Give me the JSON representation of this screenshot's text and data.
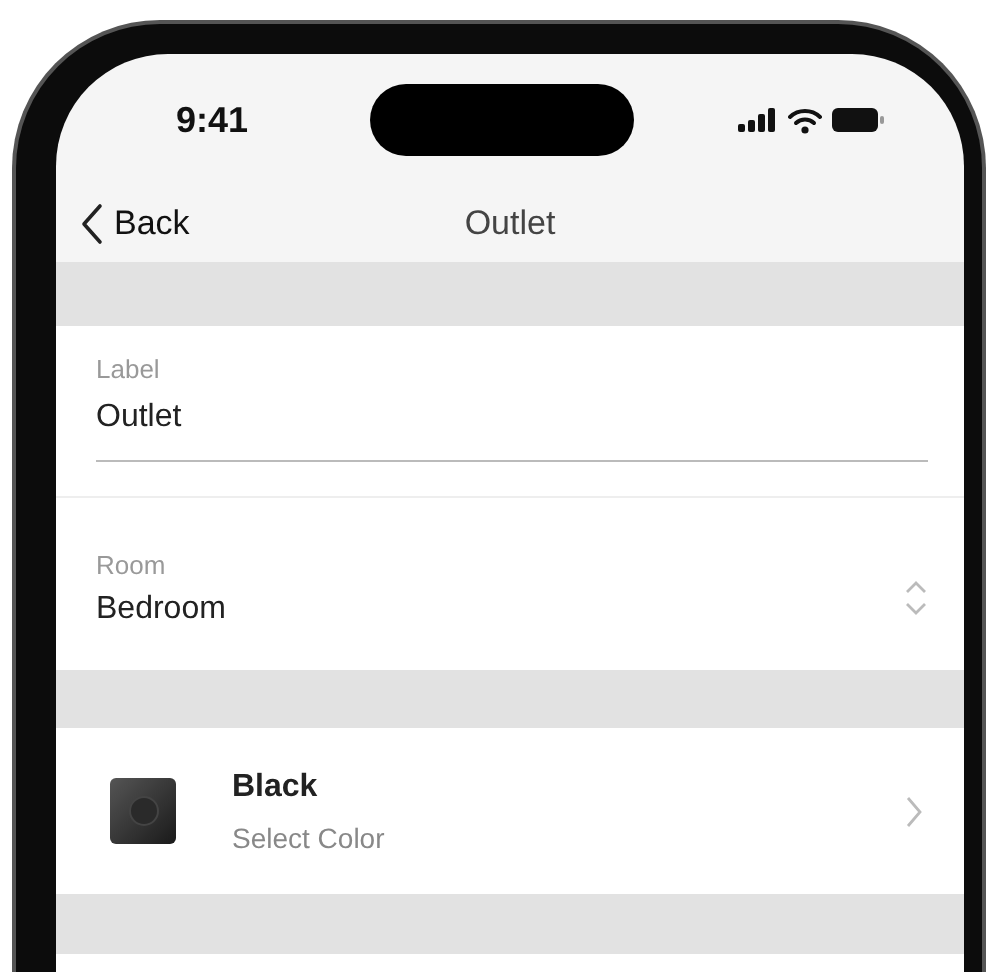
{
  "status_bar": {
    "time": "9:41"
  },
  "nav": {
    "back_label": "Back",
    "title": "Outlet"
  },
  "fields": [
    {
      "kind": "text",
      "label": "Label",
      "value": "Outlet"
    },
    {
      "kind": "select",
      "label": "Room",
      "value": "Bedroom"
    }
  ],
  "color_row": {
    "title": "Black",
    "subtitle": "Select Color"
  }
}
